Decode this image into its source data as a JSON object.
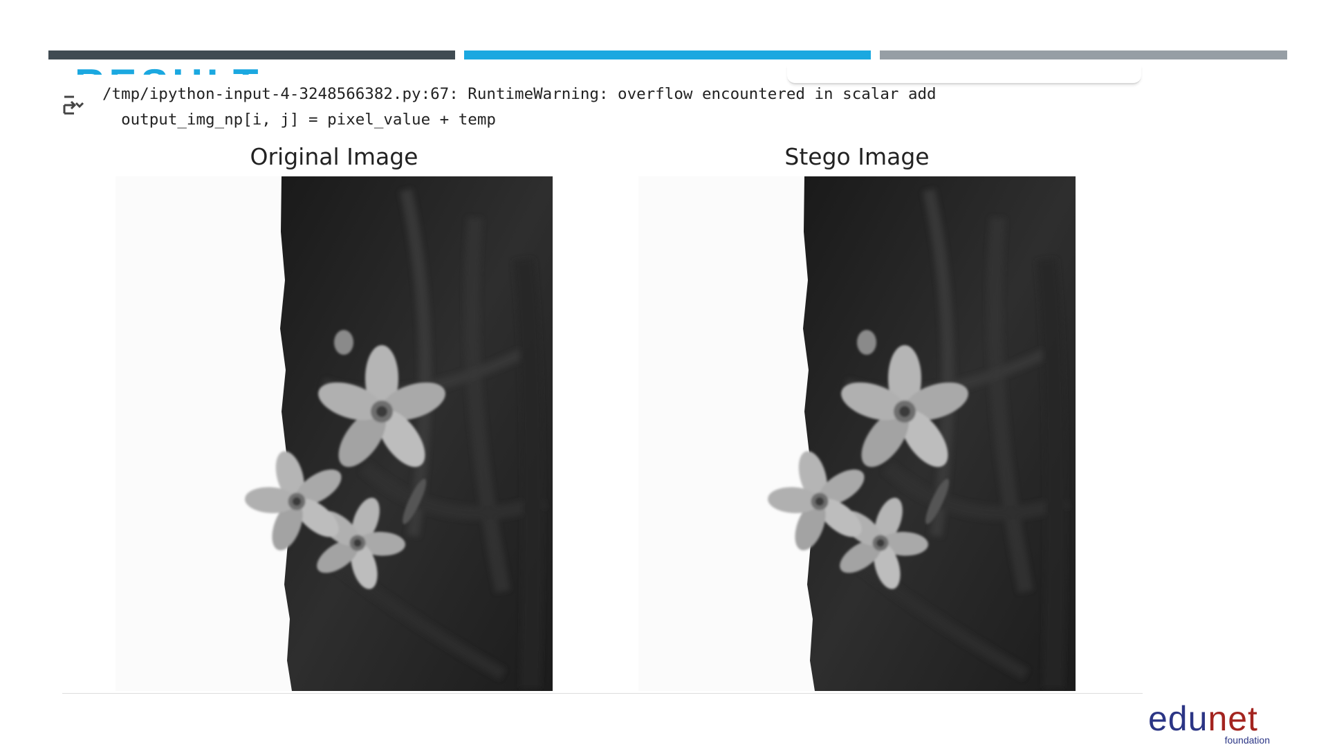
{
  "slide": {
    "heading_partial": "RESULT"
  },
  "notebook": {
    "output_lines": [
      "/tmp/ipython-input-4-3248566382.py:67: RuntimeWarning: overflow encountered in scalar add",
      "  output_img_np[i, j] = pixel_value + temp"
    ],
    "output_icon": "output-collapse-icon"
  },
  "figure": {
    "left_title": "Original Image",
    "right_title": "Stego Image"
  },
  "logo": {
    "part1": "edu",
    "part2": "net",
    "sub": "foundation"
  },
  "colors": {
    "bar_dark": "#404b52",
    "bar_blue": "#1ba8e0",
    "bar_grey": "#969ea5",
    "logo_blue": "#2b3585",
    "logo_red": "#a3241f"
  }
}
